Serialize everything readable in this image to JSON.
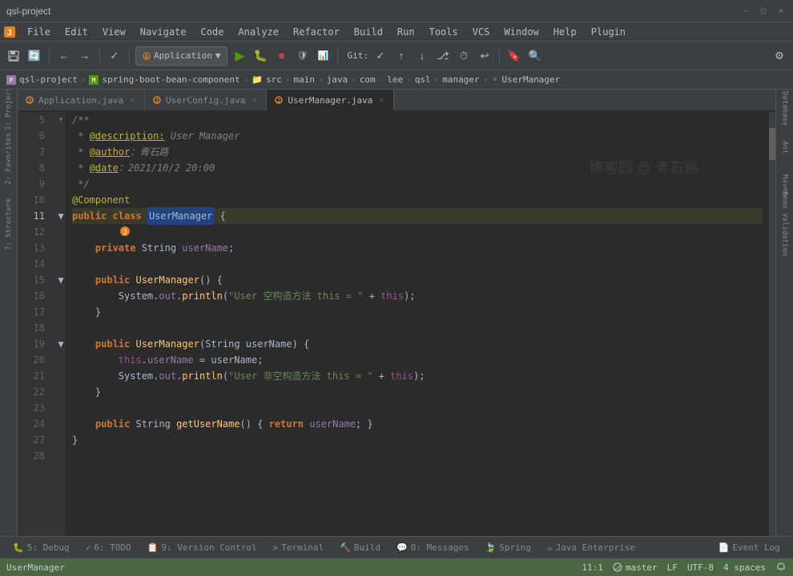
{
  "window": {
    "title": "qsl-project",
    "minimize": "—",
    "maximize": "□",
    "close": "✕"
  },
  "menubar": {
    "items": [
      "File",
      "Edit",
      "View",
      "Navigate",
      "Code",
      "Analyze",
      "Refactor",
      "Build",
      "Run",
      "Tools",
      "VCS",
      "Window",
      "Help",
      "Plugin"
    ]
  },
  "toolbar": {
    "run_config": "Application",
    "run_config_arrow": "▼",
    "git_label": "Git:",
    "icons": [
      "💾",
      "↺",
      "←",
      "→",
      "✓",
      "⚙",
      "🔧",
      "▶",
      "🐛",
      "⏹",
      "⏸",
      "⚙",
      "🔄",
      "⏱",
      "↩",
      "📁",
      "📋",
      "🔍"
    ]
  },
  "breadcrumb": {
    "items": [
      "qsl-project",
      "spring-boot-bean-component",
      "src",
      "main",
      "java",
      "com",
      "lee",
      "qsl",
      "manager",
      "UserManager"
    ]
  },
  "tabs": [
    {
      "label": "Application.java",
      "type": "java",
      "active": false
    },
    {
      "label": "UserConfig.java",
      "type": "java",
      "active": false
    },
    {
      "label": "UserManager.java",
      "type": "java",
      "active": true
    }
  ],
  "left_sidebar": {
    "items": [
      "1: Project",
      "Favorites",
      "2: Favorites",
      "7: Structure"
    ]
  },
  "right_sidebar": {
    "items": [
      "Database",
      "Ant",
      "m",
      "Maven",
      "Bean Validation"
    ]
  },
  "code": {
    "filename": "UserManager",
    "watermark": "博客园 @ 青石路",
    "lines": [
      {
        "num": 5,
        "content": "/**",
        "type": "comment-start"
      },
      {
        "num": 6,
        "content": " * @description: User Manager",
        "type": "comment"
      },
      {
        "num": 7,
        "content": " * @author：青石路",
        "type": "comment"
      },
      {
        "num": 8,
        "content": " * @date：2021/10/2 20:00",
        "type": "comment"
      },
      {
        "num": 9,
        "content": " */",
        "type": "comment-end"
      },
      {
        "num": 10,
        "content": "@Component",
        "type": "annotation"
      },
      {
        "num": 11,
        "content": "public class UserManager {",
        "type": "class-decl",
        "highlighted": true
      },
      {
        "num": 12,
        "content": "",
        "type": "empty"
      },
      {
        "num": 13,
        "content": "    private String userName;",
        "type": "field"
      },
      {
        "num": 14,
        "content": "",
        "type": "empty"
      },
      {
        "num": 15,
        "content": "    public UserManager() {",
        "type": "method"
      },
      {
        "num": 16,
        "content": "        System.out.println(\"User 空构造方法 this = \" + this);",
        "type": "code"
      },
      {
        "num": 17,
        "content": "    }",
        "type": "close"
      },
      {
        "num": 18,
        "content": "",
        "type": "empty"
      },
      {
        "num": 19,
        "content": "    public UserManager(String userName) {",
        "type": "method"
      },
      {
        "num": 20,
        "content": "        this.userName = userName;",
        "type": "code"
      },
      {
        "num": 21,
        "content": "        System.out.println(\"User 非空构造方法 this = \" + this);",
        "type": "code"
      },
      {
        "num": 22,
        "content": "    }",
        "type": "close"
      },
      {
        "num": 23,
        "content": "",
        "type": "empty"
      },
      {
        "num": 24,
        "content": "    public String getUserName() { return userName; }",
        "type": "method"
      },
      {
        "num": 27,
        "content": "}",
        "type": "close"
      },
      {
        "num": 28,
        "content": "",
        "type": "empty"
      }
    ]
  },
  "bottom_tabs": [
    {
      "label": "5: Debug",
      "icon": "🐛"
    },
    {
      "label": "6: TODO",
      "icon": "✓"
    },
    {
      "label": "9: Version Control",
      "icon": "📋"
    },
    {
      "label": "Terminal",
      "icon": ">"
    },
    {
      "label": "Build",
      "icon": "🔨"
    },
    {
      "label": "0: Messages",
      "icon": "💬"
    },
    {
      "label": "Spring",
      "icon": "🍃"
    },
    {
      "label": "Java Enterprise",
      "icon": "☕"
    },
    {
      "label": "Event Log",
      "icon": "📄"
    }
  ],
  "status_bar": {
    "class_label": "UserManager",
    "encoding": "UTF-8",
    "line_sep": "LF",
    "indent": "4 spaces",
    "git_branch": "master",
    "position": "11:1"
  }
}
